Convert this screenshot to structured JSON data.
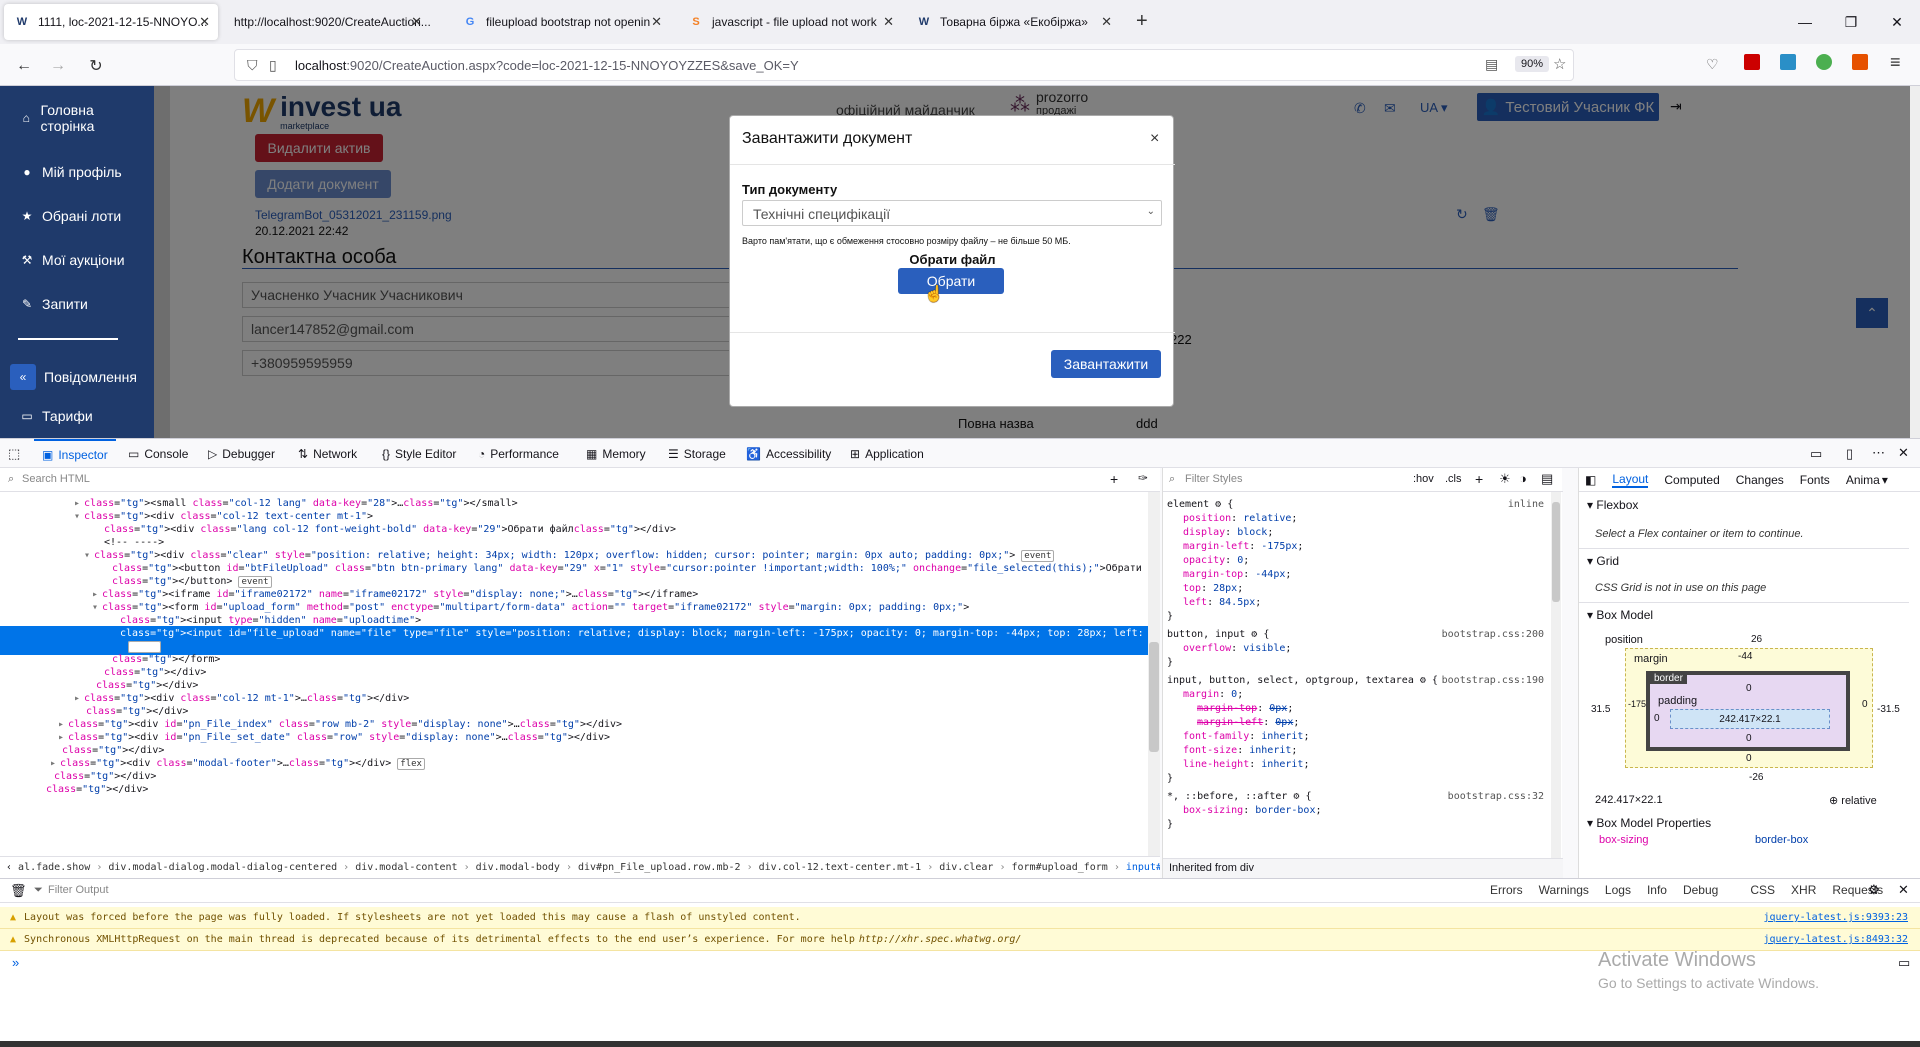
{
  "tabs": [
    {
      "title": "1111, loc-2021-12-15-NNOYO...",
      "icon": "W"
    },
    {
      "title": "http://localhost:9020/CreateAuction...",
      "icon": ""
    },
    {
      "title": "fileupload bootstrap not openin",
      "icon": "G"
    },
    {
      "title": "javascript - file upload not work",
      "icon": "S"
    },
    {
      "title": "Товарна біржа «Екобіржа»",
      "icon": "W"
    }
  ],
  "url": {
    "host": "localhost",
    "path": ":9020/CreateAuction.aspx?code=loc-2021-12-15-NNOYOYZZES&save_OK=Y",
    "zoom": "90%"
  },
  "sidebar": {
    "items": [
      {
        "label": "Головна сторінка",
        "icon": "home-icon"
      },
      {
        "label": "Мій профіль",
        "icon": "user-icon"
      },
      {
        "label": "Обрані лоти",
        "icon": "star-icon"
      },
      {
        "label": "Мої аукціони",
        "icon": "gavel-icon"
      },
      {
        "label": "Запити",
        "icon": "pen-icon"
      },
      {
        "label": "Повідомлення",
        "icon": "chevrons-left-icon"
      },
      {
        "label": "Тарифи",
        "icon": "ticket-icon"
      }
    ]
  },
  "site": {
    "logo_main": "invest ua",
    "logo_sub": "marketplace",
    "partner_text": "офіційний майданчик",
    "prozorro": "prozorro",
    "prozorro_sub": "продажі",
    "lang": "UA",
    "user_button": "Тестовий Учасник ФК",
    "delete_asset": "Видалити актив",
    "add_document": "Додати документ",
    "file_name": "TelegramBot_05312021_231159.png",
    "file_date": "20.12.2021 22:42",
    "contact_heading": "Контактна особа",
    "contact_name": "Учасненко Учасник Учасникович",
    "contact_email": "lancer147852@gmail.com",
    "contact_phone": "+380959595959",
    "full_name_label": "Повна назва",
    "full_name_value": "ddd",
    "number_fragment": "222"
  },
  "modal": {
    "title": "Завантажити документ",
    "type_label": "Тип документу",
    "type_value": "Технічні специфікації",
    "note": "Варто пам'ятати, що є обмеження стосовно розміру файлу – не більше 50 МБ.",
    "choose_label": "Обрати файл",
    "choose_button": "Обрати",
    "upload_button": "Завантажити"
  },
  "devtools": {
    "tabs": [
      "Inspector",
      "Console",
      "Debugger",
      "Network",
      "Style Editor",
      "Performance",
      "Memory",
      "Storage",
      "Accessibility",
      "Application"
    ],
    "search_placeholder": "Search HTML",
    "filter_styles": "Filter Styles",
    "hov": ":hov",
    "cls": ".cls",
    "layout_tabs": [
      "Layout",
      "Computed",
      "Changes",
      "Fonts",
      "Anima"
    ],
    "html_lines": [
      "<small class=\"col-12 lang\" data-key=\"28\">…</small>",
      "<div class=\"col-12 text-center mt-1\">",
      "<div class=\"lang col-12 font-weight-bold\" data-key=\"29\">Обрати файл</div>",
      "<!-- ---->",
      "<div class=\"clear\" style=\"position: relative; height: 34px; width: 120px; overflow: hidden; cursor: pointer; margin: 0px auto; padding: 0px;\"> event",
      "<button id=\"btFileUpload\" class=\"btn btn-primary lang\" data-key=\"29\" x=\"1\" style=\"cursor:pointer !important;width: 100%;\" onchange=\"file_selected(this);\">Обрати файл",
      "</button> event",
      "<iframe id=\"iframe02172\" name=\"iframe02172\" style=\"display: none;\">…</iframe>",
      "<form id=\"upload_form\" method=\"post\" enctype=\"multipart/form-data\" action=\"\" target=\"iframe02172\" style=\"margin: 0px; padding: 0px;\">",
      "<input type=\"hidden\" name=\"uploadtime\">",
      "<input id=\"file_upload\" name=\"file\" type=\"file\" style=\"position: relative; display: block; margin-left: -175px; opacity: 0; margin-top: -44px; top: 28px; left: 84.5px;\">",
      "event",
      "</form>",
      "</div>",
      "</div>",
      "<div class=\"col-12 mt-1\">…</div>",
      "</div>",
      "<div id=\"pn_File_index\" class=\"row mb-2\" style=\"display: none\">…</div>",
      "<div id=\"pn_File_set_date\" class=\"row\" style=\"display: none\">…</div>",
      "</div>",
      "<div class=\"modal-footer\">…</div> flex",
      "</div>",
      "</div>"
    ],
    "breadcrumbs": [
      "al.fade.show",
      "div.modal-dialog.modal-dialog-centered",
      "div.modal-content",
      "div.modal-body",
      "div#pn_File_upload.row.mb-2",
      "div.col-12.text-center.mt-1",
      "div.clear",
      "form#upload_form",
      "input#file_upload"
    ],
    "rules": {
      "element_selector": "element",
      "element_origin": "inline",
      "element_props": [
        [
          "position",
          "relative"
        ],
        [
          "display",
          "block"
        ],
        [
          "margin-left",
          "-175px"
        ],
        [
          "opacity",
          "0"
        ],
        [
          "margin-top",
          "-44px"
        ],
        [
          "top",
          "28px"
        ],
        [
          "left",
          "84.5px"
        ]
      ],
      "rule2_selector": "button, input",
      "rule2_origin": "bootstrap.css:200",
      "rule2_props": [
        [
          "overflow",
          "visible"
        ]
      ],
      "rule3_selector": "input, button, select, optgroup, textarea",
      "rule3_origin": "bootstrap.css:190",
      "rule3_props": [
        [
          "margin",
          "0"
        ],
        [
          "margin-top",
          "0px"
        ],
        [
          "margin-left",
          "0px"
        ],
        [
          "font-family",
          "inherit"
        ],
        [
          "font-size",
          "inherit"
        ],
        [
          "line-height",
          "inherit"
        ]
      ],
      "rule4_selector": "*, ::before, ::after",
      "rule4_origin": "bootstrap.css:32",
      "rule4_props": [
        [
          "box-sizing",
          "border-box"
        ]
      ],
      "inherited": "Inherited from div"
    },
    "layout": {
      "flexbox": "Flexbox",
      "flexbox_msg": "Select a Flex container or item to continue.",
      "grid": "Grid",
      "grid_msg": "CSS Grid is not in use on this page",
      "boxmodel": "Box Model",
      "position": "position",
      "pos_top": "26",
      "pos_left": "31.5",
      "pos_right": "-31.5",
      "pos_bottom": "-26",
      "margin": "margin",
      "margin_top": "-44",
      "margin_left": "-175",
      "margin_right": "0",
      "margin_bottom": "0",
      "border": "border",
      "border_val": "0",
      "padding": "padding",
      "padding_val": "0",
      "content": "242.417×22.1",
      "size": "242.417×22.1",
      "pos_type": "relative",
      "props_title": "Box Model Properties",
      "prop_name": "box-sizing",
      "prop_value": "border-box"
    },
    "console": {
      "filter": "Filter Output",
      "filters": [
        "Errors",
        "Warnings",
        "Logs",
        "Info",
        "Debug",
        "CSS",
        "XHR",
        "Requests"
      ],
      "messages": [
        {
          "text": "Layout was forced before the page was fully loaded. If stylesheets are not yet loaded this may cause a flash of unstyled content.",
          "source": "jquery-latest.js:9393:23"
        },
        {
          "text": "Synchronous XMLHttpRequest on the main thread is deprecated because of its detrimental effects to the end user’s experience. For more help ",
          "link": "http://xhr.spec.whatwg.org/",
          "source": "jquery-latest.js:8493:32"
        }
      ],
      "activate_title": "Activate Windows",
      "activate_sub": "Go to Settings to activate Windows."
    }
  }
}
